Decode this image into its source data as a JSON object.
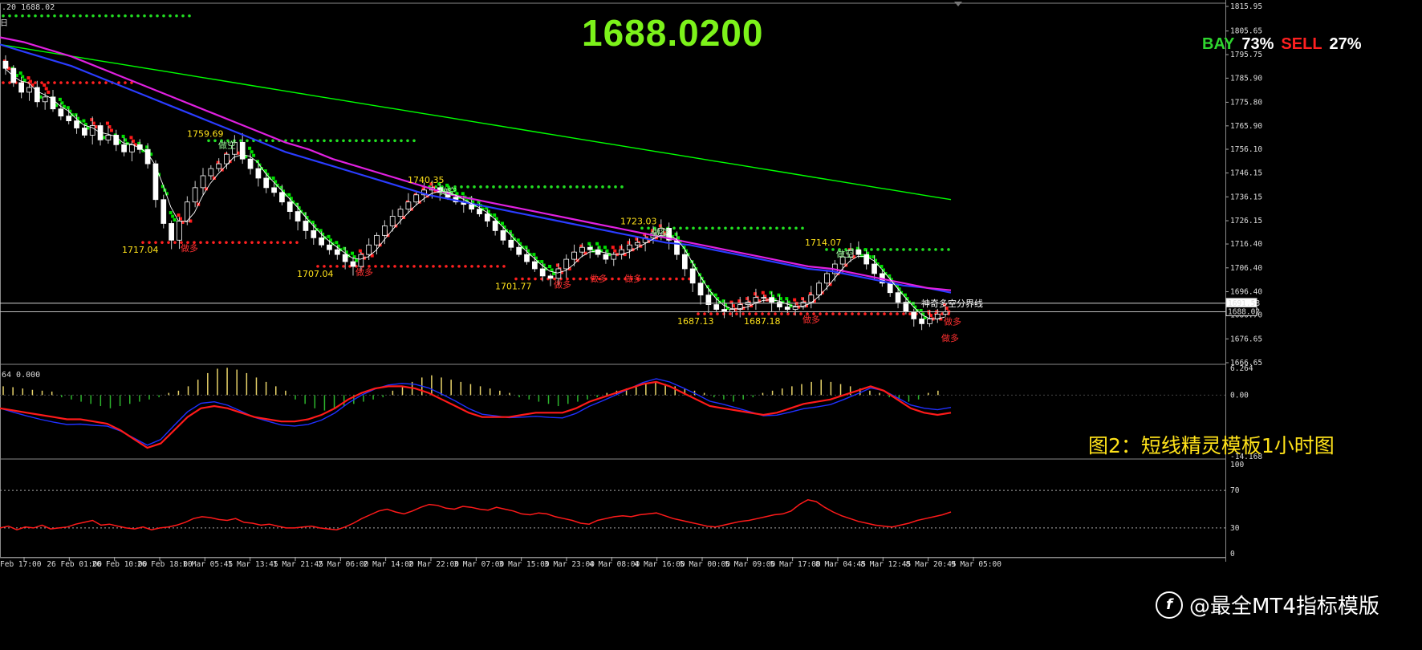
{
  "header": {
    "main_info": ".20 1688.02",
    "main_sub": "日",
    "macd_info": "64 0.000"
  },
  "current_price": "1688.0200",
  "sentiment": {
    "bay_label": "BAY",
    "bay_value": "73%",
    "sell_label": "SELL",
    "sell_value": "27%"
  },
  "caption": "图2：短线精灵模板1小时图",
  "watermark": "@最全MT4指标模版",
  "watermark_logo": "f",
  "colors": {
    "bull": "#00e000",
    "bear": "#ff1a1a",
    "ma_long": "#00ff00",
    "ma_magenta": "#e020e0",
    "ma_blue": "#2a3cff",
    "accent_text": "#ffe21a",
    "price": "#7cf21a"
  },
  "chart_data": [
    {
      "type": "line",
      "name": "main",
      "ylim": [
        1666.65,
        1815.95
      ],
      "y_ticks": [
        "1815.95",
        "1805.65",
        "1795.75",
        "1785.90",
        "1775.80",
        "1765.90",
        "1756.10",
        "1746.15",
        "1736.15",
        "1726.15",
        "1716.40",
        "1706.40",
        "1696.40",
        "1686.70",
        "1676.65",
        "1666.65"
      ],
      "x_labels": [
        "Feb 17:00",
        "26 Feb 01:00",
        "26 Feb 10:00",
        "26 Feb 18:00",
        "1 Mar 05:45",
        "1 Mar 13:45",
        "1 Mar 21:45",
        "2 Mar 06:00",
        "2 Mar 14:00",
        "2 Mar 22:00",
        "3 Mar 07:00",
        "3 Mar 15:00",
        "3 Mar 23:00",
        "4 Mar 08:00",
        "4 Mar 16:00",
        "5 Mar 00:00",
        "5 Mar 09:00",
        "5 Mar 17:00",
        "8 Mar 04:45",
        "8 Mar 12:45",
        "8 Mar 20:45",
        "9 Mar 05:00"
      ],
      "price_tags": [
        {
          "label": "1691.58",
          "value": 1691.58
        },
        {
          "label": "1688.02",
          "value": 1688.02
        }
      ],
      "boundary_line": {
        "label": "神奇多空分界线",
        "value": 1691.58
      },
      "close": [
        1790,
        1784,
        1780,
        1782,
        1776,
        1778,
        1773,
        1770,
        1768,
        1765,
        1762,
        1766,
        1760,
        1762,
        1758,
        1755,
        1758,
        1756,
        1750,
        1735,
        1725,
        1718,
        1726,
        1734,
        1740,
        1745,
        1748,
        1750,
        1754,
        1759,
        1752,
        1748,
        1744,
        1740,
        1738,
        1734,
        1730,
        1726,
        1722,
        1719,
        1716,
        1714,
        1712,
        1709,
        1707,
        1712,
        1716,
        1720,
        1724,
        1728,
        1731,
        1734,
        1737,
        1739,
        1740,
        1738,
        1736,
        1734,
        1733,
        1731,
        1729,
        1726,
        1722,
        1718,
        1715,
        1712,
        1709,
        1706,
        1703,
        1702,
        1706,
        1710,
        1713,
        1715,
        1714,
        1712,
        1710,
        1712,
        1714,
        1716,
        1717,
        1719,
        1721,
        1723,
        1718,
        1712,
        1706,
        1700,
        1695,
        1691,
        1689,
        1688,
        1689,
        1691,
        1692,
        1694,
        1694,
        1692,
        1690,
        1689,
        1690,
        1692,
        1695,
        1700,
        1704,
        1708,
        1711,
        1714,
        1712,
        1708,
        1704,
        1700,
        1696,
        1692,
        1688,
        1685,
        1683,
        1685,
        1687,
        1688
      ],
      "ma_long": [
        1800,
        1799,
        1798,
        1797,
        1796,
        1795,
        1794,
        1793,
        1792,
        1791,
        1790,
        1789,
        1788,
        1787,
        1786,
        1785,
        1784,
        1783,
        1782,
        1781,
        1780,
        1779,
        1778,
        1777,
        1776,
        1775,
        1774,
        1773,
        1772,
        1771,
        1770,
        1769,
        1768,
        1767,
        1766,
        1765,
        1764,
        1763,
        1762,
        1761,
        1760,
        1759,
        1758,
        1757,
        1756,
        1755,
        1754,
        1753,
        1752,
        1751,
        1750,
        1749,
        1748,
        1747,
        1746,
        1745,
        1744,
        1743,
        1742,
        1741,
        1740,
        1739,
        1738,
        1737,
        1736,
        1735
      ],
      "ma_magenta": [
        1803,
        1801,
        1798,
        1795,
        1791,
        1787,
        1783,
        1779,
        1775,
        1771,
        1767,
        1763,
        1759,
        1756,
        1752,
        1749,
        1746,
        1743,
        1740,
        1737,
        1735,
        1733,
        1731,
        1729,
        1727,
        1725,
        1723,
        1721,
        1719,
        1717,
        1715,
        1713,
        1711,
        1709,
        1707,
        1706,
        1704,
        1702,
        1700,
        1698,
        1697
      ],
      "ma_blue": [
        1800,
        1797,
        1794,
        1791,
        1787,
        1783,
        1779,
        1775,
        1771,
        1767,
        1763,
        1759,
        1755,
        1752,
        1749,
        1746,
        1743,
        1740,
        1737,
        1735,
        1733,
        1731,
        1729,
        1727,
        1725,
        1723,
        1721,
        1719,
        1717,
        1716,
        1714,
        1712,
        1710,
        1708,
        1706,
        1705,
        1703,
        1701,
        1699,
        1698,
        1696
      ],
      "swing_high_labels": [
        {
          "label": "1759.69",
          "value": 1759.69,
          "signal": "做空"
        },
        {
          "label": "1740.35",
          "value": 1740.35,
          "signal": "做空"
        },
        {
          "label": "1723.03",
          "value": 1723.03,
          "signal": "做空"
        },
        {
          "label": "1714.07",
          "value": 1714.07,
          "signal": "做空"
        }
      ],
      "swing_low_labels": [
        {
          "label": "1717.04",
          "value": 1717.04,
          "signal": "做多"
        },
        {
          "label": "1707.04",
          "value": 1707.04,
          "signal": "做多"
        },
        {
          "label": "1701.77",
          "value": 1701.77,
          "signal": "做多"
        },
        {
          "label": "1687.13",
          "value": 1687.13,
          "signal": ""
        },
        {
          "label": "1687.18",
          "value": 1687.18,
          "signal": "做多"
        }
      ],
      "extra_signals": [
        "做多",
        "做多",
        "做多",
        "做多"
      ]
    },
    {
      "type": "bar",
      "name": "macd",
      "ylim": [
        -14.168,
        6.264
      ],
      "y_ticks": [
        "6.264",
        "0.00",
        "-14.168"
      ],
      "histogram": [
        2.0,
        1.8,
        1.5,
        1.2,
        1.0,
        0.8,
        -0.5,
        -1.0,
        -1.5,
        -2.0,
        -2.5,
        -3.0,
        -2.5,
        -2.0,
        -1.5,
        -1.0,
        -0.5,
        0.5,
        1.0,
        2.0,
        3.5,
        5.0,
        6.0,
        6.2,
        5.8,
        5.0,
        4.0,
        3.0,
        2.0,
        1.0,
        -1.0,
        -2.0,
        -3.0,
        -3.5,
        -3.0,
        -2.5,
        -2.0,
        -1.5,
        -1.0,
        -0.5,
        1.0,
        2.0,
        3.0,
        4.0,
        4.5,
        4.0,
        3.5,
        3.0,
        2.5,
        2.0,
        1.5,
        1.0,
        0.5,
        -0.5,
        -1.0,
        -1.5,
        -2.0,
        -2.5,
        -2.0,
        -1.5,
        -1.0,
        -0.5,
        0.5,
        1.0,
        1.5,
        2.0,
        2.5,
        3.0,
        2.5,
        2.0,
        1.5,
        1.0,
        0.5,
        -0.5,
        -1.0,
        -1.5,
        -1.0,
        -0.5,
        0.5,
        1.0,
        1.5,
        2.0,
        2.5,
        3.0,
        3.5,
        3.0,
        2.5,
        2.0,
        1.5,
        1.0,
        0.5,
        -0.5,
        -1.0,
        -1.5,
        -1.0,
        0.5,
        1.0
      ],
      "signal": [
        -3.0,
        -3.5,
        -4.0,
        -4.5,
        -5.0,
        -5.5,
        -5.5,
        -6.0,
        -6.5,
        -8.0,
        -10.0,
        -12.0,
        -11.0,
        -8.0,
        -5.0,
        -3.0,
        -2.5,
        -3.0,
        -4.0,
        -5.0,
        -5.5,
        -6.0,
        -6.0,
        -5.5,
        -4.5,
        -3.0,
        -1.0,
        0.5,
        1.5,
        2.0,
        2.0,
        1.5,
        0.5,
        -1.0,
        -2.5,
        -4.0,
        -5.0,
        -5.0,
        -5.0,
        -4.5,
        -4.0,
        -4.0,
        -4.0,
        -3.0,
        -1.5,
        -0.5,
        0.5,
        1.5,
        2.5,
        3.0,
        2.0,
        0.5,
        -1.0,
        -2.5,
        -3.0,
        -3.5,
        -4.0,
        -4.5,
        -4.0,
        -3.0,
        -2.0,
        -1.5,
        -1.0,
        0.0,
        1.0,
        2.0,
        1.0,
        -1.0,
        -3.0,
        -4.0,
        -4.5,
        -4.0
      ]
    },
    {
      "type": "line",
      "name": "rsi",
      "ylim": [
        0,
        100
      ],
      "y_ticks": [
        "100",
        "70",
        "30",
        "0"
      ],
      "levels": [
        70,
        30
      ],
      "values": [
        30,
        32,
        28,
        31,
        30,
        33,
        29,
        30,
        31,
        34,
        36,
        38,
        33,
        34,
        32,
        30,
        29,
        31,
        28,
        30,
        31,
        33,
        36,
        40,
        42,
        41,
        39,
        38,
        40,
        36,
        35,
        33,
        34,
        32,
        30,
        30,
        31,
        32,
        30,
        29,
        28,
        31,
        35,
        40,
        44,
        48,
        50,
        47,
        45,
        48,
        52,
        55,
        54,
        51,
        50,
        53,
        52,
        50,
        49,
        52,
        50,
        48,
        45,
        44,
        46,
        45,
        42,
        40,
        38,
        35,
        34,
        38,
        40,
        42,
        43,
        42,
        44,
        45,
        46,
        43,
        40,
        38,
        36,
        34,
        32,
        31,
        33,
        35,
        37,
        38,
        40,
        42,
        44,
        45,
        48,
        55,
        60,
        58,
        52,
        47,
        43,
        40,
        37,
        35,
        33,
        32,
        31,
        33,
        35,
        38,
        40,
        42,
        44,
        47
      ]
    }
  ]
}
